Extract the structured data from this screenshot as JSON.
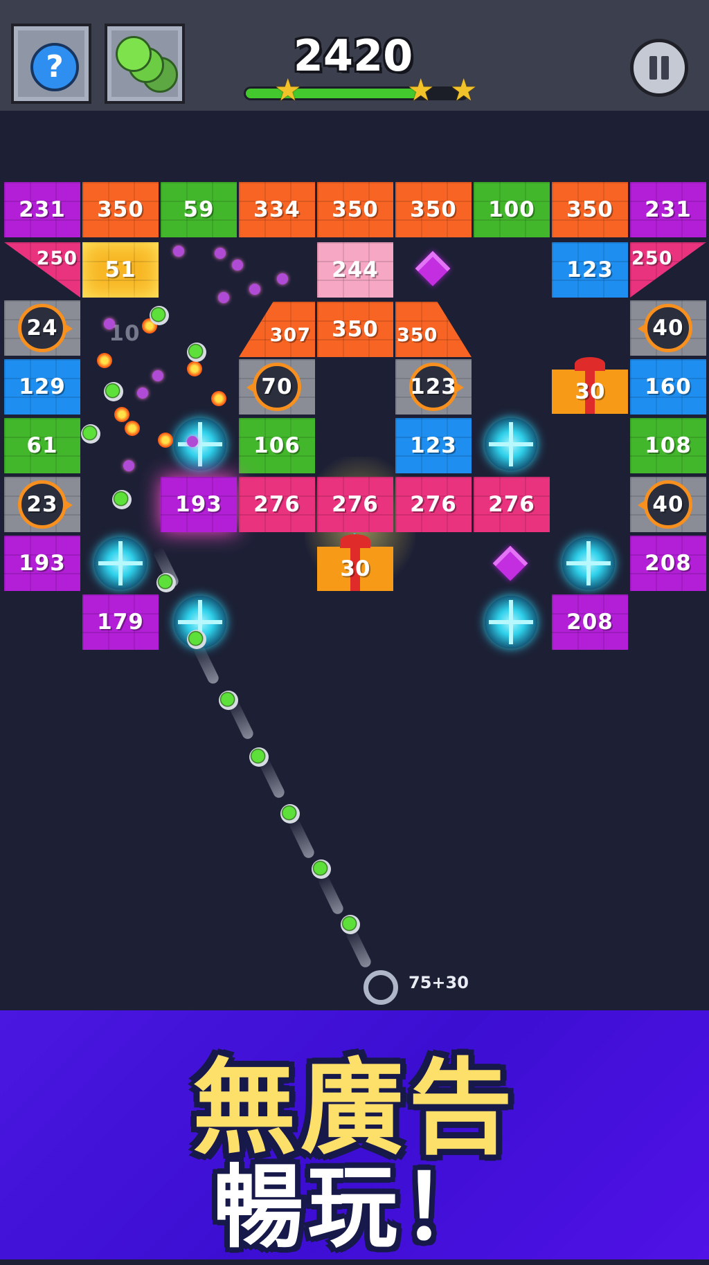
{
  "hud": {
    "score": "2420",
    "help_symbol": "?",
    "star_progress": 0.78,
    "stars_earned": 3
  },
  "colors": {
    "magenta": "#b21fd6",
    "orange": "#f86424",
    "green": "#43b72c",
    "blue": "#1e8ef0",
    "pink": "#e9337e",
    "light_pink": "#f6a7c4",
    "badge_orange": "#f7901e",
    "banner_purple": "#4a17e0",
    "banner_yellow": "#fde06a"
  },
  "bricks": {
    "row1": [
      "231",
      "350",
      "59",
      "334",
      "350",
      "350",
      "100",
      "350",
      "231"
    ],
    "tri_left": "250",
    "fire_brick": "51",
    "top_center": "244",
    "blue_right_top": "123",
    "tri_right": "250",
    "badge_left_1": "24",
    "faded_label": "10",
    "trap_left": "307",
    "center_orange": "350",
    "trap_right": "350",
    "badge_right_1": "40",
    "blue_left": "129",
    "badge_center_left": "70",
    "badge_center_right": "123",
    "gift_right": "30",
    "blue_right": "160",
    "green_left": "61",
    "green_center": "106",
    "blue_center": "123",
    "green_right": "108",
    "badge_left_2": "23",
    "magenta_mid": "193",
    "pink_row": [
      "276",
      "276",
      "276",
      "276"
    ],
    "badge_right_2": "40",
    "magenta_left": "193",
    "gift_center": "30",
    "magenta_right": "208",
    "magenta_bottom_left": "179",
    "magenta_bottom_right": "208"
  },
  "launcher": {
    "ball_count": "75+30"
  },
  "banner": {
    "line1": "無廣告",
    "line2": "暢玩！"
  }
}
